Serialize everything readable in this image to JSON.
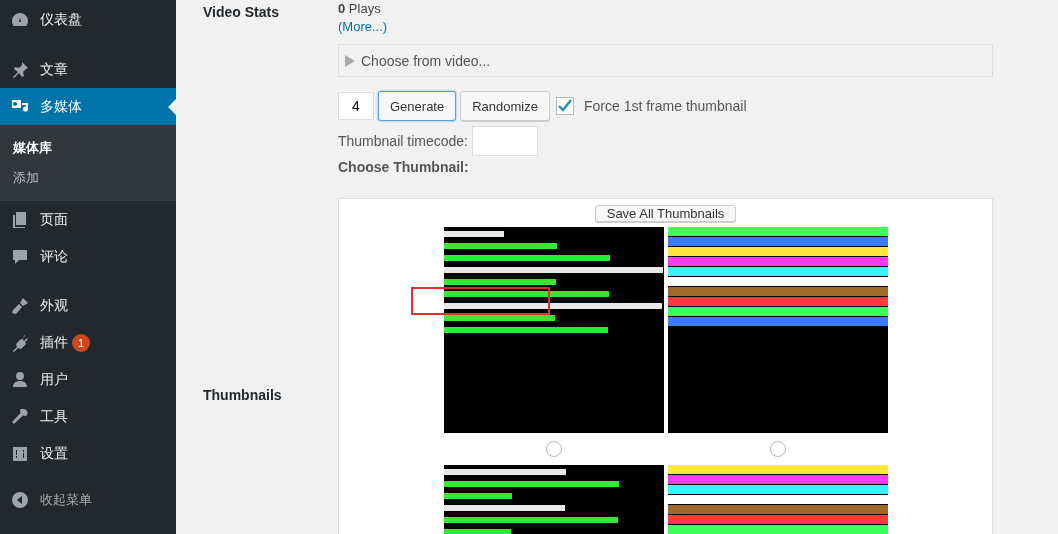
{
  "sidebar": {
    "groups": [
      [
        {
          "label": "仪表盘",
          "selected": false
        }
      ],
      [
        {
          "label": "文章",
          "selected": false
        },
        {
          "label": "多媒体",
          "selected": true,
          "children": [
            {
              "label": "媒体库",
              "selected": true
            },
            {
              "label": "添加",
              "selected": false
            }
          ]
        },
        {
          "label": "页面",
          "selected": false
        },
        {
          "label": "评论",
          "selected": false
        }
      ],
      [
        {
          "label": "外观",
          "selected": false
        },
        {
          "label": "插件",
          "selected": false,
          "badge": "1"
        },
        {
          "label": "用户",
          "selected": false
        },
        {
          "label": "工具",
          "selected": false
        },
        {
          "label": "设置",
          "selected": false
        }
      ]
    ],
    "collapse": "收起菜单"
  },
  "video_stats": {
    "label": "Video Stats",
    "plays": "**0** Plays",
    "more_link": "(More...)"
  },
  "chooser": {
    "label": "Choose from video..."
  },
  "generate": {
    "count": "4",
    "buttons": [
      {
        "label": "Generate",
        "focused": true
      },
      {
        "label": "Randomize",
        "focused": false
      }
    ],
    "force_first": {
      "label": "Force 1st frame thumbnail",
      "checked": true
    }
  },
  "timecode": {
    "label": "Thumbnail timecode:"
  },
  "choose_thumbnail": "Choose Thumbnail:",
  "thumbnails": {
    "label": "Thumbnails",
    "save_button": "Save All Thumbnails"
  }
}
